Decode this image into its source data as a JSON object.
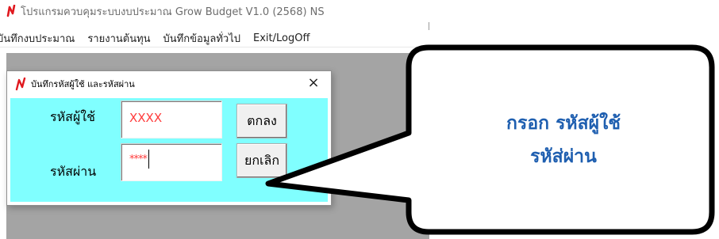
{
  "app": {
    "title": "โปรแกรมควบคุมระบบงบประมาณ Grow Budget V1.0 (2568) NS",
    "menu": [
      "บันทึกงบประมาณ",
      "รายงานต้นทุน",
      "บันทึกข้อมูลทั่วไป",
      "Exit/LogOff"
    ]
  },
  "dialog": {
    "title": "บันทึกรหัสผู้ใช้ และรหัสผ่าน",
    "close_glyph": "×",
    "username_label": "รหัสผู้ใช้",
    "password_label": "รหัสผ่าน",
    "username_value": "XXXX",
    "password_value": "****",
    "ok_label": "ตกลง",
    "cancel_label": "ยกเลิก"
  },
  "callout": {
    "line1": "กรอก รหัสผู้ใช้",
    "line2": "รหัส่ผ่าน"
  },
  "colors": {
    "dialog_body": "#80ffff",
    "input_text": "#ff3b3b",
    "callout_text": "#1f5fb0",
    "logo": "#e0191f"
  },
  "icons": {
    "app_logo": "red-n-logo-icon",
    "dialog_logo": "red-n-logo-icon",
    "close": "close-icon"
  }
}
